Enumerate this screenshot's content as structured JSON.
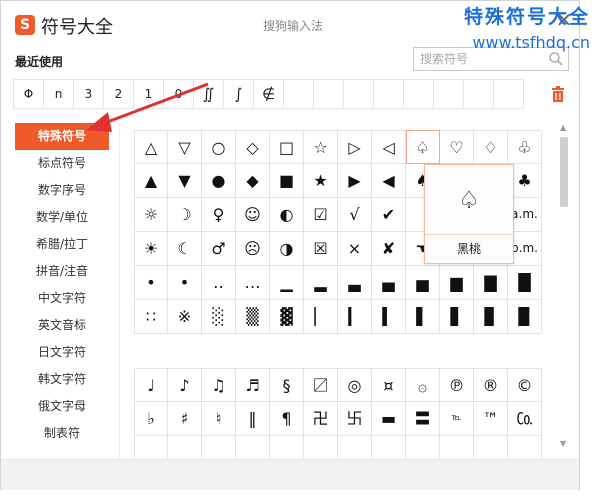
{
  "window": {
    "app_title": "符号大全",
    "ime_title": "搜狗输入法",
    "logo_text": "S",
    "close_glyph": "✕"
  },
  "watermark": {
    "line1": "特殊符号大全",
    "line2": "www.tsfhdq.cn"
  },
  "recent": {
    "label": "最近使用",
    "items": [
      "Φ",
      "n",
      "3",
      "2",
      "1",
      "0",
      "∬",
      "∫",
      "∉",
      "",
      "",
      "",
      "",
      "",
      "",
      "",
      ""
    ]
  },
  "search": {
    "placeholder": "搜索符号",
    "value": ""
  },
  "sidebar": {
    "items": [
      {
        "label": "特殊符号",
        "active": true
      },
      {
        "label": "标点符号",
        "active": false
      },
      {
        "label": "数字序号",
        "active": false
      },
      {
        "label": "数学/单位",
        "active": false
      },
      {
        "label": "希腊/拉丁",
        "active": false
      },
      {
        "label": "拼音/注音",
        "active": false
      },
      {
        "label": "中文字符",
        "active": false
      },
      {
        "label": "英文音标",
        "active": false
      },
      {
        "label": "日文字符",
        "active": false
      },
      {
        "label": "韩文字符",
        "active": false
      },
      {
        "label": "俄文字母",
        "active": false
      },
      {
        "label": "制表符",
        "active": false
      }
    ]
  },
  "grid1": [
    "△",
    "▽",
    "○",
    "◇",
    "□",
    "☆",
    "▷",
    "◁",
    "♤",
    "♡",
    "♢",
    "♧",
    "▲",
    "▼",
    "●",
    "◆",
    "■",
    "★",
    "▶",
    "◀",
    "♠",
    "☜",
    "",
    "♣",
    "☼",
    "☽",
    "♀",
    "☺",
    "◐",
    "☑",
    "√",
    "✔",
    "",
    "",
    "",
    "a.m.",
    "☀",
    "☾",
    "♂",
    "☹",
    "◑",
    "☒",
    "×",
    "✘",
    "☚",
    "",
    "",
    "p.m.",
    "•",
    "•",
    "‥",
    "…",
    "▁",
    "▂",
    "▃",
    "▄",
    "▅",
    "▆",
    "▇",
    "█",
    "∷",
    "※",
    "░",
    "▒",
    "▓",
    "▏",
    "▎",
    "▍",
    "▌",
    "▋",
    "▊",
    "▉"
  ],
  "grid2": [
    "♩",
    "♪",
    "♫",
    "♬",
    "§",
    "〼",
    "◎",
    "¤",
    "۞",
    "℗",
    "®",
    "©",
    "♭",
    "♯",
    "♮",
    "‖",
    "¶",
    "卍",
    "卐",
    "▬",
    "〓",
    "℡",
    "™",
    "㏇",
    "",
    "",
    "",
    "",
    "",
    "",
    "",
    "",
    "",
    "",
    "",
    ""
  ],
  "tooltip": {
    "symbol": "♤",
    "name": "黑桃"
  },
  "colors": {
    "accent": "#f05a28",
    "watermark": "#1e6fd9",
    "arrow": "#e03030"
  }
}
